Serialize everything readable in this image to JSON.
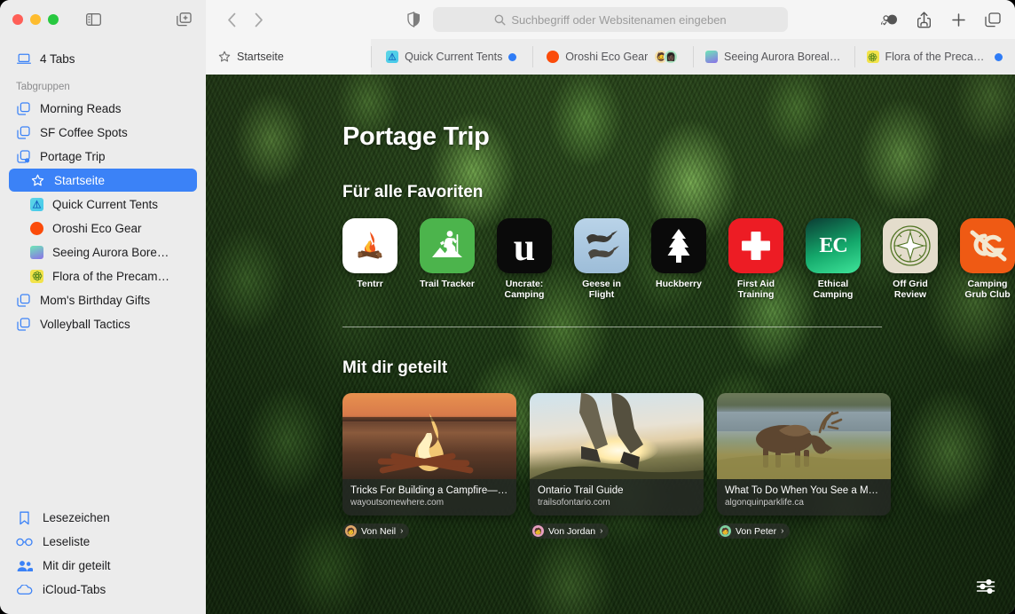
{
  "window": {
    "traffic_lights": [
      "close",
      "minimize",
      "zoom"
    ]
  },
  "sidebar": {
    "toggle_icon": "sidebar-toggle-icon",
    "new_tabgroup_icon": "new-tab-group-icon",
    "tabs_row": {
      "label": "4 Tabs",
      "icon": "laptop-icon"
    },
    "section_label": "Tabgruppen",
    "groups_top": [
      {
        "label": "Morning Reads",
        "icon": "tab-group-icon"
      },
      {
        "label": "SF Coffee Spots",
        "icon": "tab-group-icon"
      },
      {
        "label": "Portage Trip",
        "icon": "tab-group-shared-icon"
      }
    ],
    "portage_children": [
      {
        "label": "Startseite",
        "icon": "star-icon",
        "selected": true
      },
      {
        "label": "Quick Current Tents",
        "icon": "favicon-tent",
        "selected": false
      },
      {
        "label": "Oroshi Eco Gear",
        "icon": "favicon-orange-dot",
        "selected": false
      },
      {
        "label": "Seeing Aurora Bore…",
        "icon": "favicon-aurora",
        "selected": false
      },
      {
        "label": "Flora of the Precam…",
        "icon": "favicon-flora",
        "selected": false
      }
    ],
    "groups_bottom": [
      {
        "label": "Mom's Birthday Gifts",
        "icon": "tab-group-icon"
      },
      {
        "label": "Volleyball Tactics",
        "icon": "tab-group-icon"
      }
    ],
    "footer": [
      {
        "label": "Lesezeichen",
        "icon": "bookmark-icon"
      },
      {
        "label": "Leseliste",
        "icon": "glasses-icon"
      },
      {
        "label": "Mit dir geteilt",
        "icon": "shared-with-you-icon"
      },
      {
        "label": "iCloud-Tabs",
        "icon": "cloud-icon"
      }
    ]
  },
  "toolbar": {
    "back_icon": "chevron-left-icon",
    "forward_icon": "chevron-right-icon",
    "privacy_icon": "shield-icon",
    "search": {
      "icon": "search-icon",
      "placeholder": "Suchbegriff oder Websitenamen eingeben",
      "value": ""
    },
    "right_icons": [
      "share-group-icon",
      "share-icon",
      "new-tab-icon",
      "tab-overview-icon"
    ]
  },
  "tabbar": {
    "home_tab": {
      "label": "Startseite",
      "icon": "star-icon"
    },
    "tabs": [
      {
        "label": "Quick Current Tents",
        "favicon": "favicon-tent",
        "unread": true,
        "avatars": []
      },
      {
        "label": "Oroshi Eco Gear",
        "favicon": "favicon-orange-dot",
        "unread": false,
        "avatars": [
          "avatar-person-1",
          "avatar-person-2"
        ]
      },
      {
        "label": "Seeing Aurora Boreali…",
        "favicon": "favicon-aurora",
        "unread": false,
        "avatars": []
      },
      {
        "label": "Flora of the Precambi…",
        "favicon": "favicon-flora",
        "unread": true,
        "avatars": []
      }
    ]
  },
  "page": {
    "title": "Portage Trip",
    "favorites_heading": "Für alle Favoriten",
    "favorites": [
      {
        "label": "Tentrr",
        "icon": "campfire-icon",
        "bg": "#ffffff"
      },
      {
        "label": "Trail Tracker",
        "icon": "hiker-icon",
        "bg": "#4cb44c"
      },
      {
        "label": "Uncrate: Camping",
        "icon": "letter-u-icon",
        "bg": "#0a0a0a"
      },
      {
        "label": "Geese in Flight",
        "icon": "geese-icon",
        "bg": "#a9c6e0"
      },
      {
        "label": "Huckberry",
        "icon": "pine-tree-icon",
        "bg": "#0a0a0a"
      },
      {
        "label": "First Aid Training",
        "icon": "red-cross-icon",
        "bg": "#ed1c24"
      },
      {
        "label": "Ethical Camping",
        "icon": "letters-ec-icon",
        "bg": "#12c87a"
      },
      {
        "label": "Off Grid Review",
        "icon": "compass-icon",
        "bg": "#e4ddcc"
      },
      {
        "label": "Camping Grub Club",
        "icon": "letters-cg-icon",
        "bg": "#ef5a14"
      }
    ],
    "shared_heading": "Mit dir geteilt",
    "shared_cards": [
      {
        "title": "Tricks For Building a Campfire—F…",
        "url": "wayoutsomewhere.com",
        "image": "campfire-at-sunset-photo",
        "byline": "Von Neil",
        "chevron": "chevron-right-icon"
      },
      {
        "title": "Ontario Trail Guide",
        "url": "trailsofontario.com",
        "image": "hiker-legs-sunset-photo",
        "byline": "Von Jordan",
        "chevron": "chevron-right-icon"
      },
      {
        "title": "What To Do When You See a Moo…",
        "url": "algonquinparklife.ca",
        "image": "moose-grazing-by-lake-photo",
        "byline": "Von Peter",
        "chevron": "chevron-right-icon"
      }
    ],
    "settings_icon": "sliders-icon",
    "background": "aerial-forest-canopy-photo"
  },
  "colors": {
    "accent": "#3b82f7",
    "sidebar_bg": "#ececec",
    "toolbar_bg": "#f5f5f5",
    "unread_dot": "#2f7cf6"
  }
}
